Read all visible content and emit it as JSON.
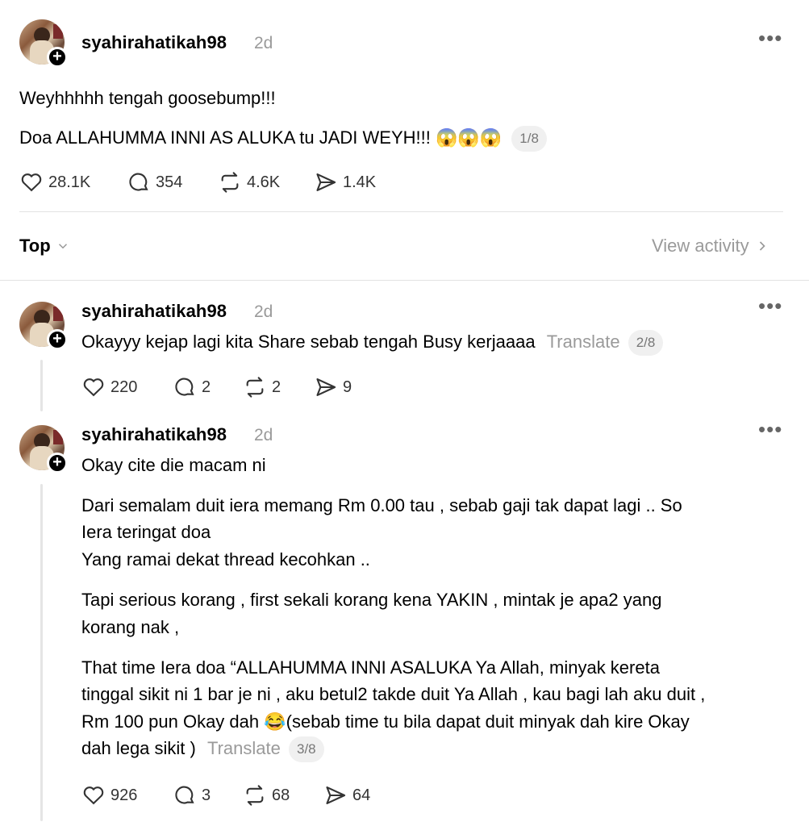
{
  "post": {
    "username": "syahirahatikah98",
    "time": "2d",
    "line1": "Weyhhhhh tengah goosebump!!!",
    "line2": "Doa ALLAHUMMA INNI AS ALUKA tu JADI WEYH!!! 😱😱😱",
    "pager": "1/8",
    "likes": "28.1K",
    "comments": "354",
    "reposts": "4.6K",
    "shares": "1.4K"
  },
  "sort": {
    "label": "Top",
    "view_activity": "View activity"
  },
  "reply1": {
    "username": "syahirahatikah98",
    "time": "2d",
    "text": "Okayyy kejap lagi kita Share sebab tengah Busy kerjaaaa",
    "translate": "Translate",
    "pager": "2/8",
    "likes": "220",
    "comments": "2",
    "reposts": "2",
    "shares": "9"
  },
  "reply2": {
    "username": "syahirahatikah98",
    "time": "2d",
    "p1": "Okay cite die macam ni",
    "p2_l1": "Dari semalam duit iera memang Rm 0.00 tau , sebab gaji tak dapat lagi .. So",
    "p2_l2": "Iera teringat doa",
    "p2_l3": "Yang ramai dekat thread kecohkan ..",
    "p3_l1": "Tapi serious korang , first sekali korang kena YAKIN , mintak je apa2 yang",
    "p3_l2": "korang nak ,",
    "p4_l1": "That time Iera doa “ALLAHUMMA INNI ASALUKA Ya Allah, minyak kereta",
    "p4_l2": "tinggal sikit ni 1 bar je ni , aku betul2 takde duit Ya Allah , kau bagi lah aku duit ,",
    "p4_l3": "Rm 100 pun Okay dah 😂(sebab time tu bila dapat duit minyak dah kire Okay",
    "p4_l4": "dah lega sikit )",
    "translate": "Translate",
    "pager": "3/8",
    "likes": "926",
    "comments": "3",
    "reposts": "68",
    "shares": "64"
  },
  "icons": {
    "like": "heart-icon",
    "comment": "comment-bubble-icon",
    "repost": "repost-arrows-icon",
    "share": "paper-plane-icon",
    "more": "more-dots-icon",
    "follow": "plus-icon",
    "chevron_down": "chevron-down-icon",
    "chevron_right": "chevron-right-icon"
  }
}
